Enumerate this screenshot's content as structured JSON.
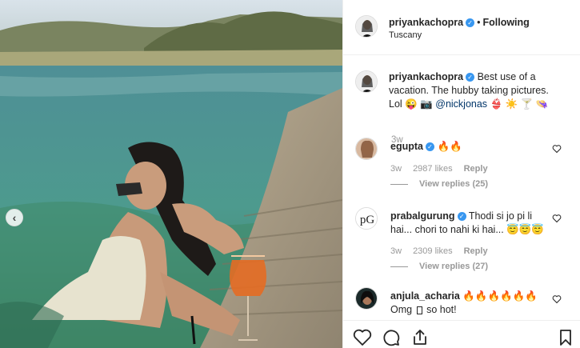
{
  "post": {
    "username": "priyankachopra",
    "follow_label": "Following",
    "location": "Tuscany",
    "caption_text": "Best use of a vacation. The hubby taking pictures. Lol 😜 📷",
    "caption_mention": "@nickjonas",
    "caption_emojis": "👙 ☀️ 🍸 👒",
    "caption_time": "3w"
  },
  "comments": [
    {
      "username": "egupta",
      "text": "🔥🔥",
      "time": "3w",
      "likes": "2987 likes",
      "reply": "Reply",
      "view_replies": "View replies (25)"
    },
    {
      "username": "prabalgurung",
      "text": "Thodi si jo pi li hai... chori to nahi ki hai... 😇😇😇",
      "time": "3w",
      "likes": "2309 likes",
      "reply": "Reply",
      "view_replies": "View replies (27)"
    },
    {
      "username": "anjula_acharia",
      "text": "🔥🔥🔥🔥🔥🔥",
      "text2": "Omg",
      "text2_tail": "so hot!"
    }
  ],
  "icons": {
    "carousel_prev": "chevron-left-icon",
    "verified": "verified-badge-icon",
    "like": "heart-icon",
    "comment": "comment-icon",
    "share": "share-icon",
    "save": "bookmark-icon"
  },
  "colors": {
    "verified": "#3897f0",
    "mention": "#003569",
    "meta": "#999999"
  }
}
